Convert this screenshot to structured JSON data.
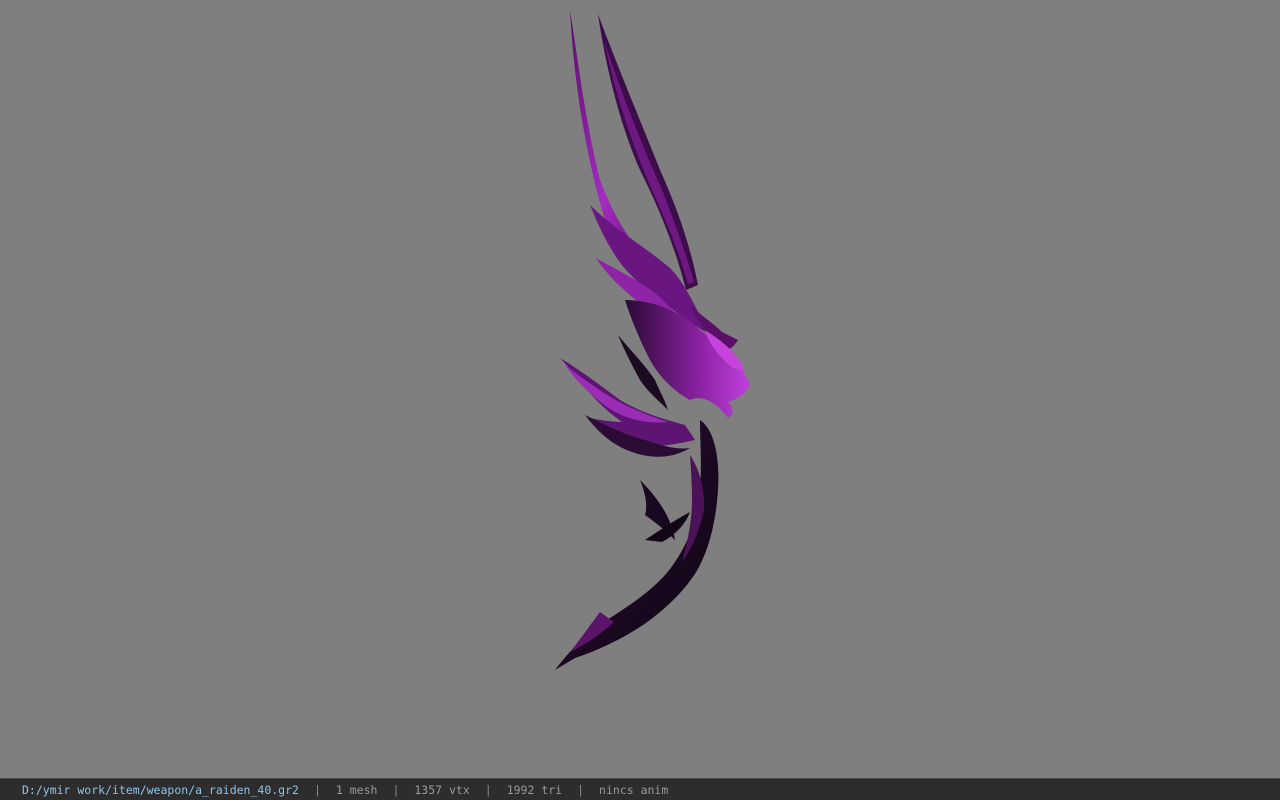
{
  "viewer": {
    "background_color": "#7f7f7f",
    "model": {
      "icon": "weapon-model",
      "primary_color": "#8a1f9a",
      "highlight_color": "#b030c8",
      "dark_color": "#1a0a1e"
    }
  },
  "statusbar": {
    "file_path": "D:/ymir work/item/weapon/a_raiden_40.gr2",
    "mesh_count": "1 mesh",
    "vertex_count": "1357 vtx",
    "tri_count": "1992 tri",
    "anim_info": "nincs anim",
    "separator": "|",
    "path_color": "#8fc3e8"
  }
}
